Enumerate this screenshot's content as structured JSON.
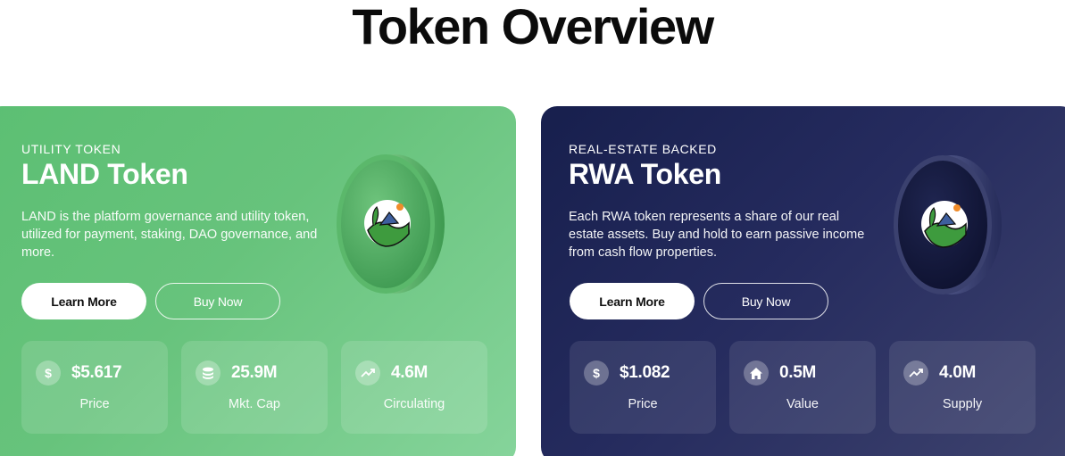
{
  "page": {
    "title": "Token Overview"
  },
  "cards": [
    {
      "eyebrow": "UTILITY TOKEN",
      "title": "LAND Token",
      "description": "LAND is the platform governance and utility token, utilized for payment, staking, DAO governance, and more.",
      "primary_button": "Learn More",
      "secondary_button": "Buy Now",
      "coin_icon": "land-logo-icon",
      "stats": [
        {
          "icon": "dollar-icon",
          "value": "$5.617",
          "label": "Price"
        },
        {
          "icon": "coins-stack-icon",
          "value": "25.9M",
          "label": "Mkt. Cap"
        },
        {
          "icon": "trend-up-icon",
          "value": "4.6M",
          "label": "Circulating"
        }
      ]
    },
    {
      "eyebrow": "REAL-ESTATE BACKED",
      "title": "RWA Token",
      "description": "Each RWA token represents a share of our real estate assets. Buy and hold to earn passive income from cash flow properties.",
      "primary_button": "Learn More",
      "secondary_button": "Buy Now",
      "coin_icon": "land-logo-icon",
      "stats": [
        {
          "icon": "dollar-icon",
          "value": "$1.082",
          "label": "Price"
        },
        {
          "icon": "home-icon",
          "value": "0.5M",
          "label": "Value"
        },
        {
          "icon": "trend-up-icon",
          "value": "4.0M",
          "label": "Supply"
        }
      ]
    }
  ],
  "colors": {
    "land_card": "#67c37c",
    "rwa_card": "#252b5e",
    "coin_green": "#4fa85e",
    "coin_navy": "#141a3d"
  }
}
